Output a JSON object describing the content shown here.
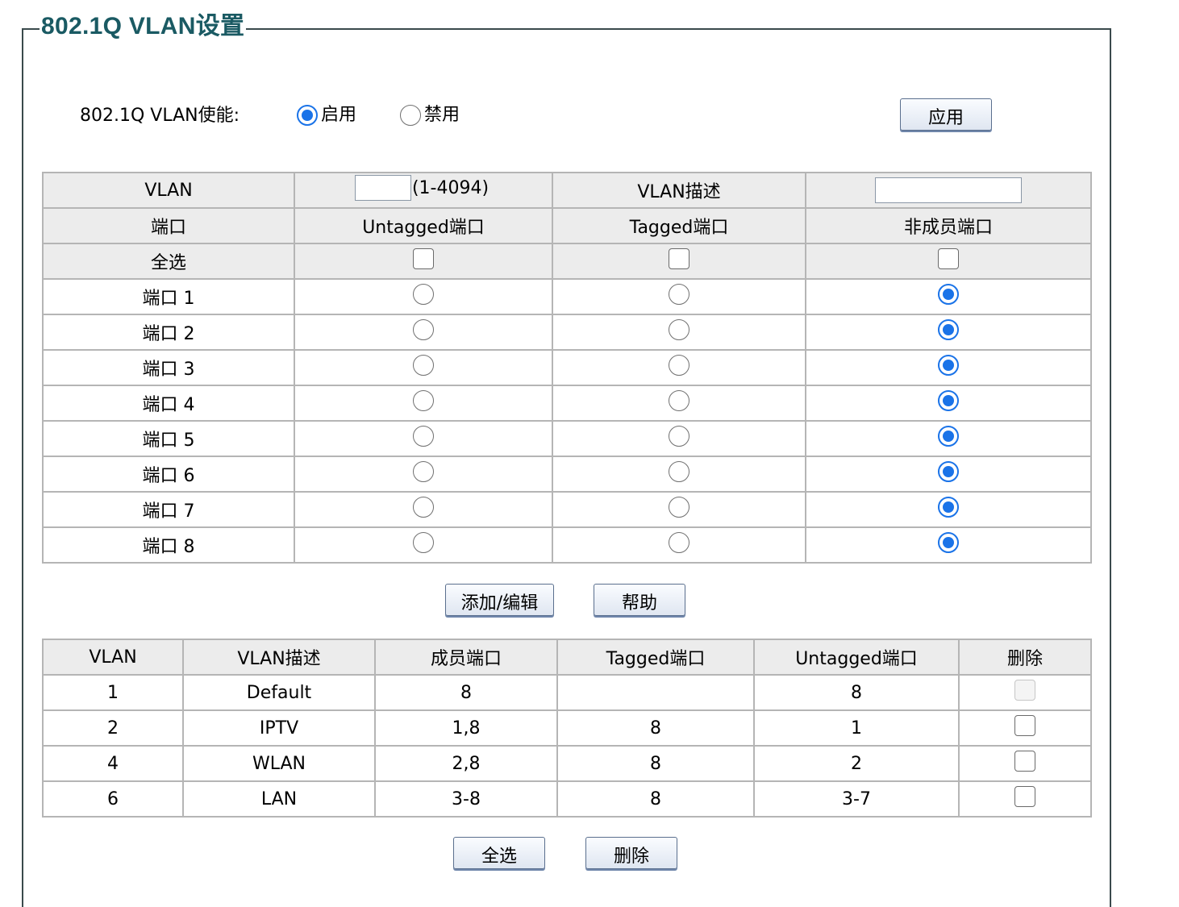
{
  "title": "802.1Q VLAN设置",
  "enable": {
    "label": "802.1Q VLAN使能:",
    "options": [
      {
        "label": "启用",
        "selected": true
      },
      {
        "label": "禁用",
        "selected": false
      }
    ],
    "apply_label": "应用"
  },
  "config": {
    "vlan_label": "VLAN",
    "vlan_id_value": "",
    "vlan_range_hint": "(1-4094)",
    "desc_label": "VLAN描述",
    "desc_value": "",
    "columns": [
      "端口",
      "Untagged端口",
      "Tagged端口",
      "非成员端口"
    ],
    "select_all_label": "全选",
    "ports": [
      {
        "name": "端口 1",
        "mode": "non-member"
      },
      {
        "name": "端口 2",
        "mode": "non-member"
      },
      {
        "name": "端口 3",
        "mode": "non-member"
      },
      {
        "name": "端口 4",
        "mode": "non-member"
      },
      {
        "name": "端口 5",
        "mode": "non-member"
      },
      {
        "name": "端口 6",
        "mode": "non-member"
      },
      {
        "name": "端口 7",
        "mode": "non-member"
      },
      {
        "name": "端口 8",
        "mode": "non-member"
      }
    ],
    "add_edit_label": "添加/编辑",
    "help_label": "帮助"
  },
  "vlan_table": {
    "headers": [
      "VLAN",
      "VLAN描述",
      "成员端口",
      "Tagged端口",
      "Untagged端口",
      "删除"
    ],
    "rows": [
      {
        "vlan": "1",
        "desc": "Default",
        "members": "8",
        "tagged": "",
        "untagged": "8",
        "delete_disabled": true
      },
      {
        "vlan": "2",
        "desc": "IPTV",
        "members": "1,8",
        "tagged": "8",
        "untagged": "1",
        "delete_disabled": false
      },
      {
        "vlan": "4",
        "desc": "WLAN",
        "members": "2,8",
        "tagged": "8",
        "untagged": "2",
        "delete_disabled": false
      },
      {
        "vlan": "6",
        "desc": "LAN",
        "members": "3-8",
        "tagged": "8",
        "untagged": "3-7",
        "delete_disabled": false
      }
    ],
    "select_all_label": "全选",
    "delete_label": "删除"
  },
  "colors": {
    "title": "#1a5a63",
    "radio_selected": "#1a73e8",
    "header_bg": "#ececec",
    "border": "#b5b5b5"
  }
}
